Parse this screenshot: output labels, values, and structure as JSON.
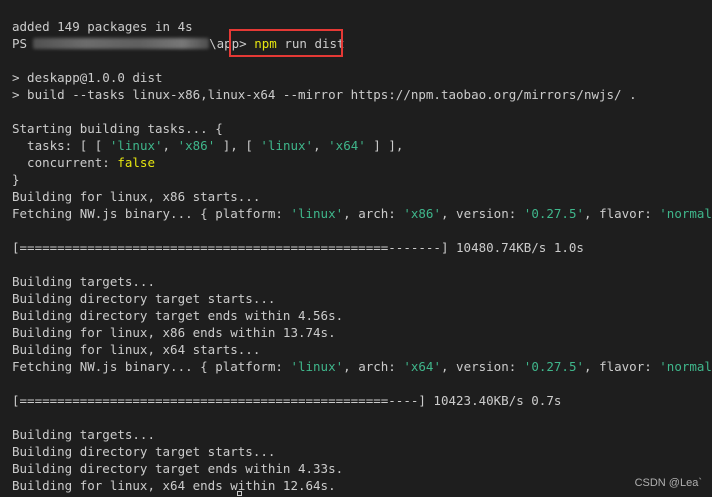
{
  "lines": {
    "l1": "added 149 packages in 4s",
    "prompt_ps": "PS",
    "prompt_suffix": "\\app>",
    "cmd_npm": "npm",
    "cmd_rest": " run dist",
    "l3": "> deskapp@1.0.0 dist",
    "l4": "> build --tasks linux-x86,linux-x64 --mirror https://npm.taobao.org/mirrors/nwjs/ .",
    "l5": "Starting building tasks... {",
    "l6a": "  tasks: [ [ ",
    "l6_s1": "'linux'",
    "l6b": ", ",
    "l6_s2": "'x86'",
    "l6c": " ], [ ",
    "l6_s3": "'linux'",
    "l6d": ", ",
    "l6_s4": "'x64'",
    "l6e": " ] ],",
    "l7a": "  concurrent: ",
    "l7_b": "false",
    "l8": "}",
    "l9": "Building for linux, x86 starts...",
    "l10a": "Fetching NW.js binary... { platform: ",
    "l10_s1": "'linux'",
    "l10b": ", arch: ",
    "l10_s2": "'x86'",
    "l10c": ", version: ",
    "l10_s3": "'0.27.5'",
    "l10d": ", flavor: ",
    "l10_s4": "'normal'",
    "l10e": " }",
    "l11": "[=================================================-------] 10480.74KB/s 1.0s",
    "l12": "Building targets...",
    "l13": "Building directory target starts...",
    "l14": "Building directory target ends within 4.56s.",
    "l15": "Building for linux, x86 ends within 13.74s.",
    "l16": "Building for linux, x64 starts...",
    "l17a": "Fetching NW.js binary... { platform: ",
    "l17_s1": "'linux'",
    "l17b": ", arch: ",
    "l17_s2": "'x64'",
    "l17c": ", version: ",
    "l17_s3": "'0.27.5'",
    "l17d": ", flavor: ",
    "l17_s4": "'normal'",
    "l17e": " }",
    "l18": "[=================================================----] 10423.40KB/s 0.7s",
    "l19": "Building targets...",
    "l20": "Building directory target starts...",
    "l21": "Building directory target ends within 4.33s.",
    "l22": "Building for linux, x64 ends within 12.64s."
  },
  "watermark": "CSDN @Lea`",
  "colors": {
    "background": "#1e1e1e",
    "text": "#cccccc",
    "string": "#3fb68b",
    "keyword": "#e5e510",
    "highlight_border": "#e53935"
  }
}
